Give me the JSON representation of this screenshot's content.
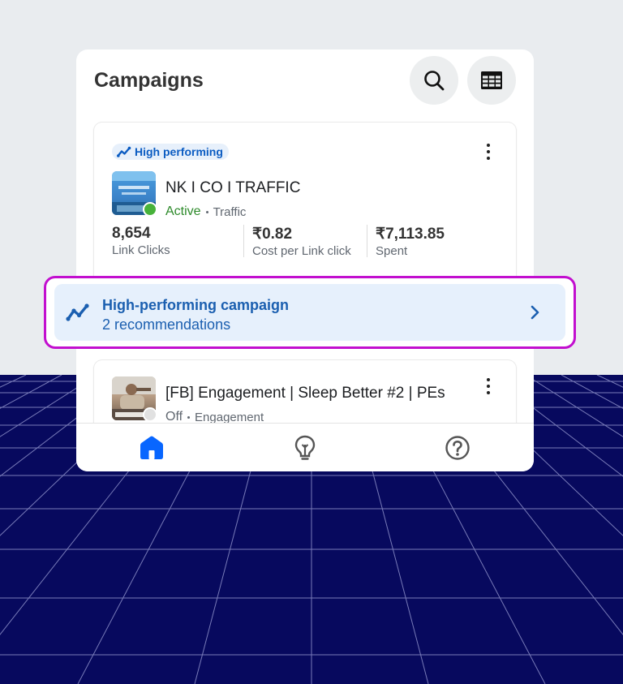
{
  "header": {
    "title": "Campaigns",
    "search_icon": "search-icon",
    "table_icon": "table-view-icon"
  },
  "campaigns": [
    {
      "badge": "High performing",
      "name": "NK I CO I TRAFFIC",
      "status": "Active",
      "objective": "Traffic",
      "metrics": [
        {
          "value": "8,654",
          "label": "Link Clicks"
        },
        {
          "value": "₹0.82",
          "label": "Cost per Link click"
        },
        {
          "value": "₹7,113.85",
          "label": "Spent"
        }
      ]
    },
    {
      "name": "[FB] Engagement | Sleep Better #2 | PEs",
      "status": "Off",
      "objective": "Engagement"
    }
  ],
  "recommendation": {
    "title": "High-performing campaign",
    "subtitle": "2 recommendations"
  },
  "bottom_nav": [
    {
      "icon": "home-icon",
      "active": true
    },
    {
      "icon": "lightbulb-icon",
      "active": false
    },
    {
      "icon": "help-icon",
      "active": false
    }
  ],
  "colors": {
    "accent": "#0866ff",
    "recommendation_text": "#1b5fb0",
    "active_status": "#2d8a2a",
    "highlight_border": "#c20fcf",
    "background_grid": "#07095e"
  }
}
